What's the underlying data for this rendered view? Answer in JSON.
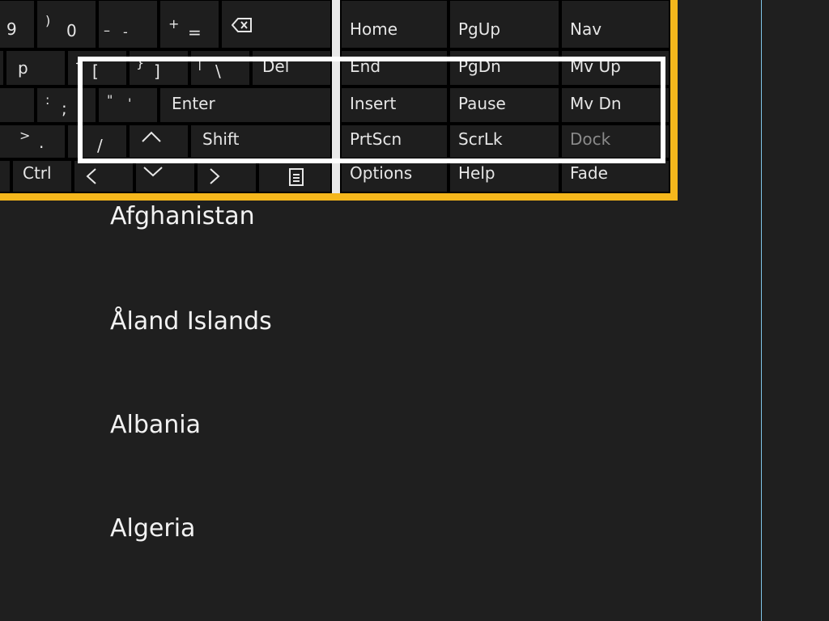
{
  "keyboard": {
    "row1": {
      "nine": "9",
      "rparen": ")",
      "zero": "0",
      "minus": "–",
      "minus2": "-",
      "plus": "+",
      "equals": "=",
      "home": "Home",
      "pgup": "PgUp",
      "nav": "Nav"
    },
    "row2": {
      "p": "p",
      "lbrace": "{",
      "lbracket": "[",
      "rbrace": "}",
      "rbracket": "]",
      "pipe": "|",
      "backslash": "\\",
      "del": "Del",
      "end": "End",
      "pgdn": "PgDn",
      "mvup": "Mv Up"
    },
    "row3": {
      "colon": ":",
      "semicolon": ";",
      "dquote": "\"",
      "squote": "'",
      "enter": "Enter",
      "insert": "Insert",
      "pause": "Pause",
      "mvdn": "Mv Dn"
    },
    "row4": {
      "gt": ">",
      "period": ".",
      "slash": "/",
      "shift": "Shift",
      "prtscn": "PrtScn",
      "scrlk": "ScrLk",
      "dock": "Dock"
    },
    "row5": {
      "ctrl": "Ctrl",
      "options": "Options",
      "help": "Help",
      "fade": "Fade"
    }
  },
  "countries": [
    "Afghanistan",
    "Åland Islands",
    "Albania",
    "Algeria"
  ],
  "colors": {
    "accent_border": "#f5b71c",
    "background": "#1f1f1f",
    "scroll_line": "#7fc4e8"
  }
}
